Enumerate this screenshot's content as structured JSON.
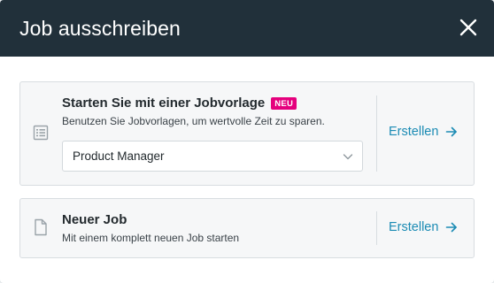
{
  "modal": {
    "title": "Job ausschreiben"
  },
  "template_card": {
    "title": "Starten Sie mit einer Jobvorlage",
    "badge": "NEU",
    "subtitle": "Benutzen Sie Jobvorlagen, um wertvolle Zeit zu sparen.",
    "select_value": "Product Manager",
    "action_label": "Erstellen"
  },
  "new_job_card": {
    "title": "Neuer Job",
    "subtitle": "Mit einem komplett neuen Job starten",
    "action_label": "Erstellen"
  },
  "colors": {
    "header_bg": "#21303a",
    "accent": "#1b8bb4",
    "badge": "#e5007d"
  }
}
